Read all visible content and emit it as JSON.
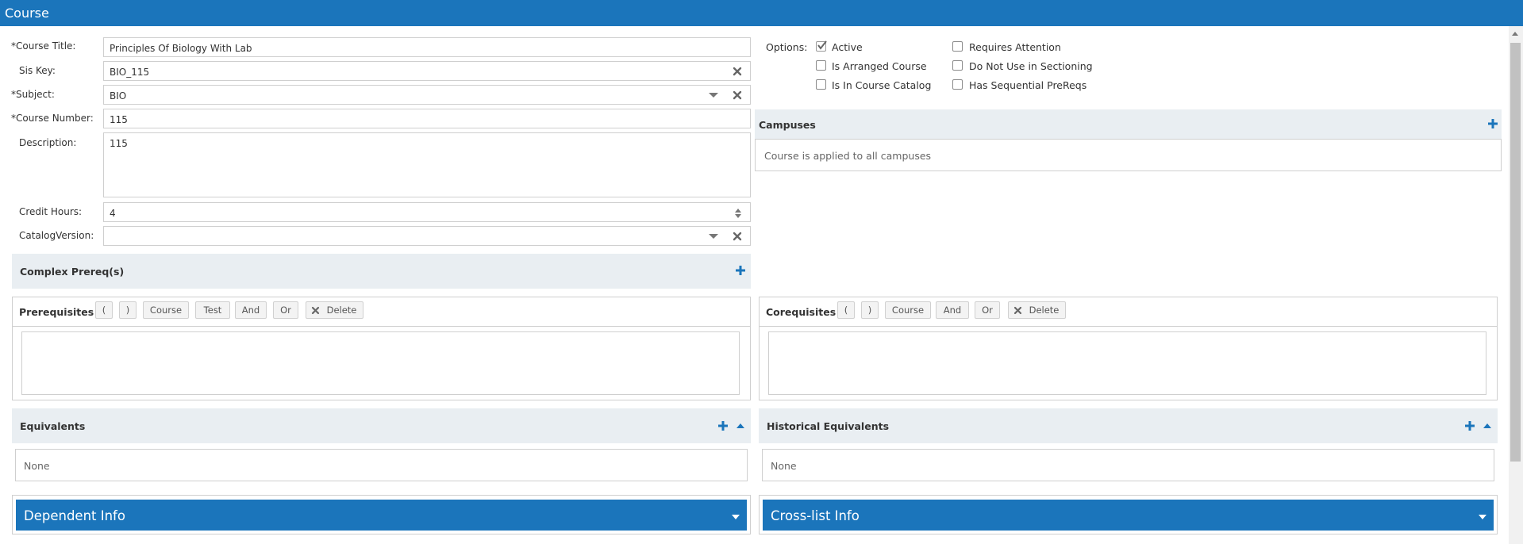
{
  "window": {
    "title": "Course"
  },
  "form": {
    "required_marker": "*",
    "course_title": {
      "label": "Course Title:",
      "value": "Principles Of Biology With Lab"
    },
    "sis_key": {
      "label": "Sis Key:",
      "value": "BIO_115"
    },
    "subject": {
      "label": "Subject:",
      "value": "BIO"
    },
    "course_number": {
      "label": "Course Number:",
      "value": "115"
    },
    "description": {
      "label": "Description:",
      "value": "115"
    },
    "credit_hours": {
      "label": "Credit Hours:",
      "value": "4"
    },
    "catalog_version": {
      "label": "CatalogVersion:",
      "value": ""
    }
  },
  "options": {
    "label": "Options:",
    "items": [
      {
        "label": "Active",
        "checked": true
      },
      {
        "label": "Is Arranged Course",
        "checked": false
      },
      {
        "label": "Is In Course Catalog",
        "checked": false
      },
      {
        "label": "Requires Attention",
        "checked": false
      },
      {
        "label": "Do Not Use in Sectioning",
        "checked": false
      },
      {
        "label": "Has Sequential PreReqs",
        "checked": false
      }
    ]
  },
  "campuses": {
    "title": "Campuses",
    "text": "Course is applied to all campuses"
  },
  "complex_prereqs": {
    "title": "Complex Prereq(s)"
  },
  "prerequisites": {
    "title": "Prerequisites",
    "buttons": [
      "(",
      ")",
      "Course",
      "Test",
      "And",
      "Or",
      "Delete"
    ]
  },
  "corequisites": {
    "title": "Corequisites",
    "buttons": [
      "(",
      ")",
      "Course",
      "And",
      "Or",
      "Delete"
    ]
  },
  "equivalents": {
    "title": "Equivalents",
    "value": "None"
  },
  "historical_equivalents": {
    "title": "Historical Equivalents",
    "value": "None"
  },
  "dependent_info": {
    "title": "Dependent Info"
  },
  "crosslist_info": {
    "title": "Cross-list Info"
  },
  "icons": {
    "clear": "x-icon",
    "dropdown": "caret-down-icon",
    "spinner": "spinner-icon",
    "add": "plus-icon",
    "collapse": "caret-up-icon",
    "expand": "caret-down-icon"
  },
  "colors": {
    "accent": "#1b75bb",
    "section_bg": "#e9eef2",
    "border": "#cfcfcf"
  }
}
